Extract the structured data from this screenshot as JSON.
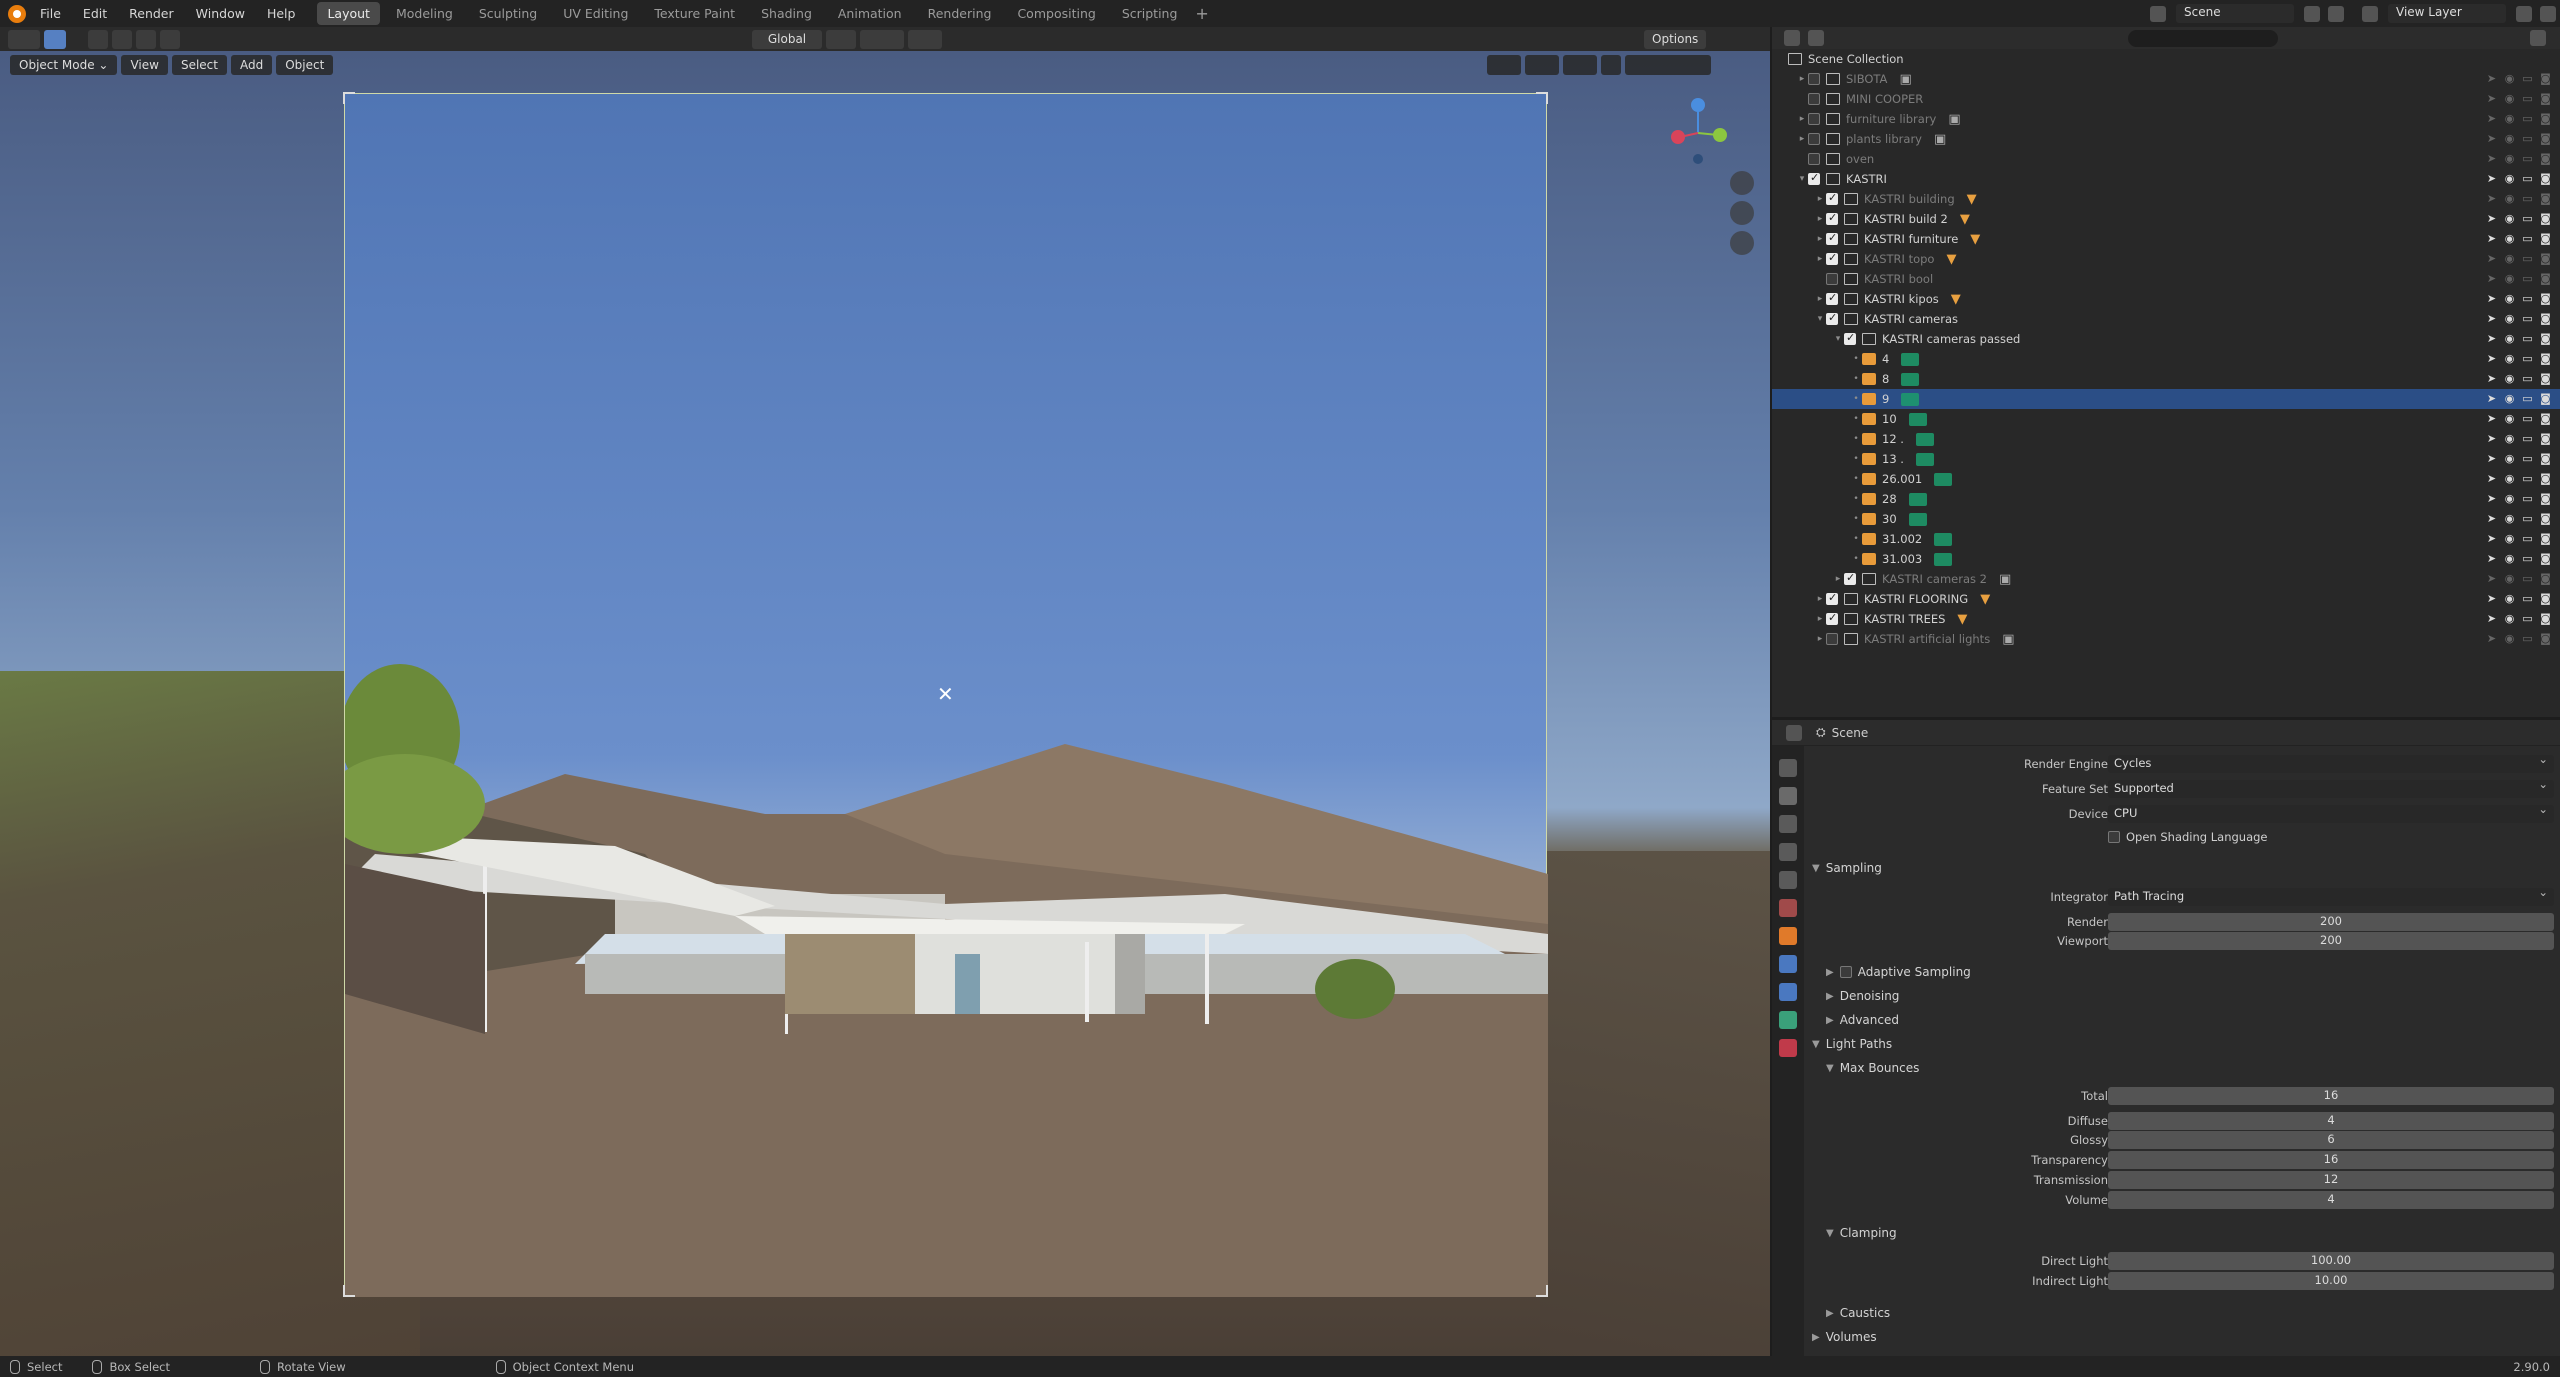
{
  "topbar": {
    "menus": [
      "File",
      "Edit",
      "Render",
      "Window",
      "Help"
    ],
    "workspaces": [
      "Layout",
      "Modeling",
      "Sculpting",
      "UV Editing",
      "Texture Paint",
      "Shading",
      "Animation",
      "Rendering",
      "Compositing",
      "Scripting"
    ],
    "active_workspace": "Layout",
    "scene": "Scene",
    "view_layer": "View Layer"
  },
  "toolheader": {
    "orientation": "Global",
    "options": "Options"
  },
  "viewport": {
    "mode": "Object Mode",
    "menus": [
      "View",
      "Select",
      "Add",
      "Object"
    ]
  },
  "outliner": {
    "root": "Scene Collection",
    "rows": [
      {
        "label": "SIBOTA",
        "depth": 1,
        "expand": "▸",
        "checked": false,
        "dim": true,
        "icon": "collection",
        "tag": "cam",
        "tag_num": "",
        "vis": false,
        "sel": false
      },
      {
        "label": "MINI COOPER",
        "depth": 1,
        "expand": "",
        "checked": false,
        "dim": true,
        "icon": "collection",
        "tag": "",
        "vis": false,
        "sel": false
      },
      {
        "label": "furniture library",
        "depth": 1,
        "expand": "▸",
        "checked": false,
        "dim": true,
        "icon": "collection",
        "tag": "cam",
        "vis": false,
        "sel": false
      },
      {
        "label": "plants library",
        "depth": 1,
        "expand": "▸",
        "checked": false,
        "dim": true,
        "icon": "collection",
        "tag": "cam",
        "vis": false,
        "sel": false
      },
      {
        "label": "oven",
        "depth": 1,
        "expand": "",
        "checked": false,
        "dim": true,
        "icon": "collection",
        "tag": "",
        "vis": false,
        "sel": false
      },
      {
        "label": "KASTRI",
        "depth": 1,
        "expand": "▾",
        "checked": true,
        "dim": false,
        "icon": "collection",
        "tag": "",
        "vis": true,
        "sel": false
      },
      {
        "label": "KASTRI building",
        "depth": 2,
        "expand": "▸",
        "checked": true,
        "dim": true,
        "icon": "collection",
        "tag": "mesh",
        "vis": false,
        "sel": false
      },
      {
        "label": "KASTRI build 2",
        "depth": 2,
        "expand": "▸",
        "checked": true,
        "dim": false,
        "icon": "collection",
        "tag": "mesh",
        "vis": true,
        "sel": false
      },
      {
        "label": "KASTRI furniture",
        "depth": 2,
        "expand": "▸",
        "checked": true,
        "dim": false,
        "icon": "collection",
        "tag": "mesh",
        "vis": true,
        "sel": false
      },
      {
        "label": "KASTRI topo",
        "depth": 2,
        "expand": "▸",
        "checked": true,
        "dim": true,
        "icon": "collection",
        "tag": "mesh",
        "vis": false,
        "sel": false
      },
      {
        "label": "KASTRI bool",
        "depth": 2,
        "expand": "",
        "checked": false,
        "dim": true,
        "icon": "collection",
        "tag": "",
        "vis": false,
        "sel": false
      },
      {
        "label": "KASTRI kipos",
        "depth": 2,
        "expand": "▸",
        "checked": true,
        "dim": false,
        "icon": "collection",
        "tag": "mesh",
        "vis": true,
        "sel": false
      },
      {
        "label": "KASTRI cameras",
        "depth": 2,
        "expand": "▾",
        "checked": true,
        "dim": false,
        "icon": "collection",
        "tag": "",
        "vis": true,
        "sel": false
      },
      {
        "label": "KASTRI cameras passed",
        "depth": 3,
        "expand": "▾",
        "checked": true,
        "dim": false,
        "icon": "collection",
        "tag": "",
        "vis": true,
        "sel": false
      },
      {
        "label": "4",
        "depth": 4,
        "expand": "•",
        "checked": null,
        "dim": false,
        "icon": "camera",
        "tag": "camdata",
        "vis": true,
        "sel": false
      },
      {
        "label": "8",
        "depth": 4,
        "expand": "•",
        "checked": null,
        "dim": false,
        "icon": "camera",
        "tag": "camdata",
        "vis": true,
        "sel": false
      },
      {
        "label": "9",
        "depth": 4,
        "expand": "•",
        "checked": null,
        "dim": false,
        "icon": "camera",
        "tag": "camdata",
        "vis": true,
        "sel": true
      },
      {
        "label": "10",
        "depth": 4,
        "expand": "•",
        "checked": null,
        "dim": false,
        "icon": "camera",
        "tag": "camdata",
        "vis": true,
        "sel": false
      },
      {
        "label": "12 .",
        "depth": 4,
        "expand": "•",
        "checked": null,
        "dim": false,
        "icon": "camera",
        "tag": "camdata",
        "vis": true,
        "sel": false
      },
      {
        "label": "13 .",
        "depth": 4,
        "expand": "•",
        "checked": null,
        "dim": false,
        "icon": "camera",
        "tag": "camdata",
        "vis": true,
        "sel": false
      },
      {
        "label": "26.001",
        "depth": 4,
        "expand": "•",
        "checked": null,
        "dim": false,
        "icon": "camera",
        "tag": "camdata",
        "vis": true,
        "sel": false
      },
      {
        "label": "28",
        "depth": 4,
        "expand": "•",
        "checked": null,
        "dim": false,
        "icon": "camera",
        "tag": "camdata",
        "vis": true,
        "sel": false
      },
      {
        "label": "30",
        "depth": 4,
        "expand": "•",
        "checked": null,
        "dim": false,
        "icon": "camera",
        "tag": "camdata",
        "vis": true,
        "sel": false
      },
      {
        "label": "31.002",
        "depth": 4,
        "expand": "•",
        "checked": null,
        "dim": false,
        "icon": "camera",
        "tag": "camdata",
        "vis": true,
        "sel": false
      },
      {
        "label": "31.003",
        "depth": 4,
        "expand": "•",
        "checked": null,
        "dim": false,
        "icon": "camera",
        "tag": "camdata",
        "vis": true,
        "sel": false
      },
      {
        "label": "KASTRI cameras 2",
        "depth": 3,
        "expand": "▸",
        "checked": true,
        "dim": true,
        "icon": "collection",
        "tag": "cam",
        "vis": false,
        "sel": false
      },
      {
        "label": "KASTRI FLOORING",
        "depth": 2,
        "expand": "▸",
        "checked": true,
        "dim": false,
        "icon": "collection",
        "tag": "mesh",
        "vis": true,
        "sel": false
      },
      {
        "label": "KASTRI TREES",
        "depth": 2,
        "expand": "▸",
        "checked": true,
        "dim": false,
        "icon": "collection",
        "tag": "mesh",
        "vis": true,
        "sel": false
      },
      {
        "label": "KASTRI artificial lights",
        "depth": 2,
        "expand": "▸",
        "checked": false,
        "dim": true,
        "icon": "collection",
        "tag": "cam",
        "vis": false,
        "sel": false
      }
    ]
  },
  "properties": {
    "context": "Scene",
    "render_engine_label": "Render Engine",
    "render_engine": "Cycles",
    "feature_set_label": "Feature Set",
    "feature_set": "Supported",
    "device_label": "Device",
    "device": "CPU",
    "osl_label": "Open Shading Language",
    "sampling": "Sampling",
    "integrator_label": "Integrator",
    "integrator": "Path Tracing",
    "render_label": "Render",
    "render_samples": "200",
    "viewport_label": "Viewport",
    "viewport_samples": "200",
    "adaptive": "Adaptive Sampling",
    "denoising": "Denoising",
    "advanced": "Advanced",
    "light_paths": "Light Paths",
    "max_bounces": "Max Bounces",
    "bounces": [
      {
        "label": "Total",
        "value": "16"
      },
      {
        "label": "Diffuse",
        "value": "4"
      },
      {
        "label": "Glossy",
        "value": "6"
      },
      {
        "label": "Transparency",
        "value": "16"
      },
      {
        "label": "Transmission",
        "value": "12"
      },
      {
        "label": "Volume",
        "value": "4"
      }
    ],
    "clamping": "Clamping",
    "direct_light_label": "Direct Light",
    "direct_light": "100.00",
    "indirect_light_label": "Indirect Light",
    "indirect_light": "10.00",
    "caustics": "Caustics",
    "volumes": "Volumes"
  },
  "statusbar": {
    "select": "Select",
    "box_select": "Box Select",
    "rotate": "Rotate View",
    "context_menu": "Object Context Menu",
    "version": "2.90.0"
  }
}
